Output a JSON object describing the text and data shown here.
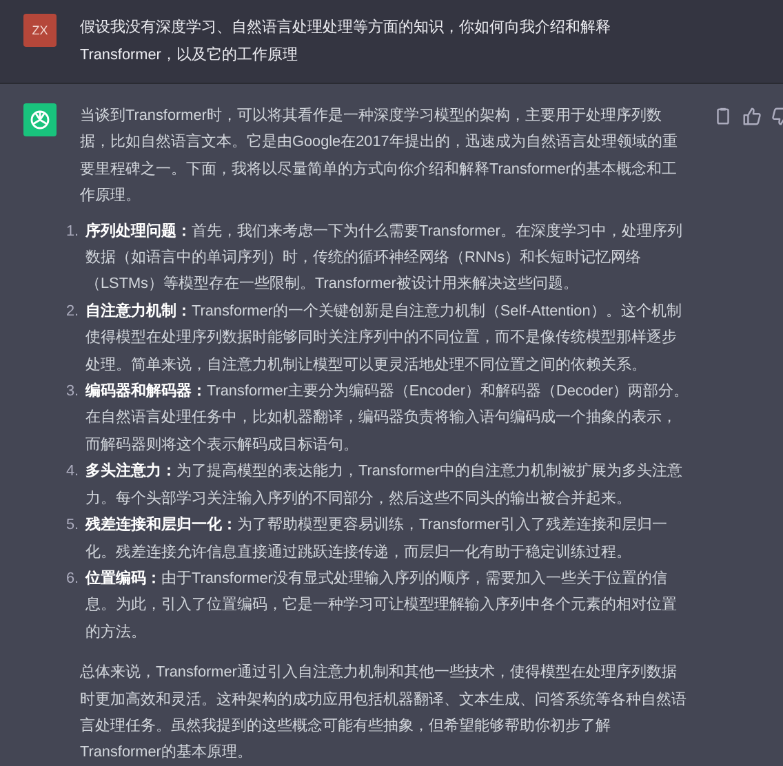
{
  "user_message": {
    "avatar": "ZX",
    "text": "假设我没有深度学习、自然语言处理处理等方面的知识，你如何向我介绍和解释Transformer，以及它的工作原理"
  },
  "assistant_message": {
    "intro": "当谈到Transformer时，可以将其看作是一种深度学习模型的架构，主要用于处理序列数据，比如自然语言文本。它是由Google在2017年提出的，迅速成为自然语言处理领域的重要里程碑之一。下面，我将以尽量简单的方式向你介绍和解释Transformer的基本概念和工作原理。",
    "points": [
      {
        "number": "1.",
        "title": "序列处理问题：",
        "body": "首先，我们来考虑一下为什么需要Transformer。在深度学习中，处理序列数据（如语言中的单词序列）时，传统的循环神经网络（RNNs）和长短时记忆网络（LSTMs）等模型存在一些限制。Transformer被设计用来解决这些问题。"
      },
      {
        "number": "2.",
        "title": "自注意力机制：",
        "body": "Transformer的一个关键创新是自注意力机制（Self-Attention）。这个机制使得模型在处理序列数据时能够同时关注序列中的不同位置，而不是像传统模型那样逐步处理。简单来说，自注意力机制让模型可以更灵活地处理不同位置之间的依赖关系。"
      },
      {
        "number": "3.",
        "title": "编码器和解码器：",
        "body": "Transformer主要分为编码器（Encoder）和解码器（Decoder）两部分。在自然语言处理任务中，比如机器翻译，编码器负责将输入语句编码成一个抽象的表示，而解码器则将这个表示解码成目标语句。"
      },
      {
        "number": "4.",
        "title": "多头注意力：",
        "body": "为了提高模型的表达能力，Transformer中的自注意力机制被扩展为多头注意力。每个头部学习关注输入序列的不同部分，然后这些不同头的输出被合并起来。"
      },
      {
        "number": "5.",
        "title": "残差连接和层归一化：",
        "body": "为了帮助模型更容易训练，Transformer引入了残差连接和层归一化。残差连接允许信息直接通过跳跃连接传递，而层归一化有助于稳定训练过程。"
      },
      {
        "number": "6.",
        "title": "位置编码：",
        "body": "由于Transformer没有显式处理输入序列的顺序，需要加入一些关于位置的信息。为此，引入了位置编码，它是一种学习可让模型理解输入序列中各个元素的相对位置的方法。"
      }
    ],
    "summary": "总体来说，Transformer通过引入自注意力机制和其他一些技术，使得模型在处理序列数据时更加高效和灵活。这种架构的成功应用包括机器翻译、文本生成、问答系统等各种自然语言处理任务。虽然我提到的这些概念可能有些抽象，但希望能够帮助你初步了解Transformer的基本原理。"
  }
}
